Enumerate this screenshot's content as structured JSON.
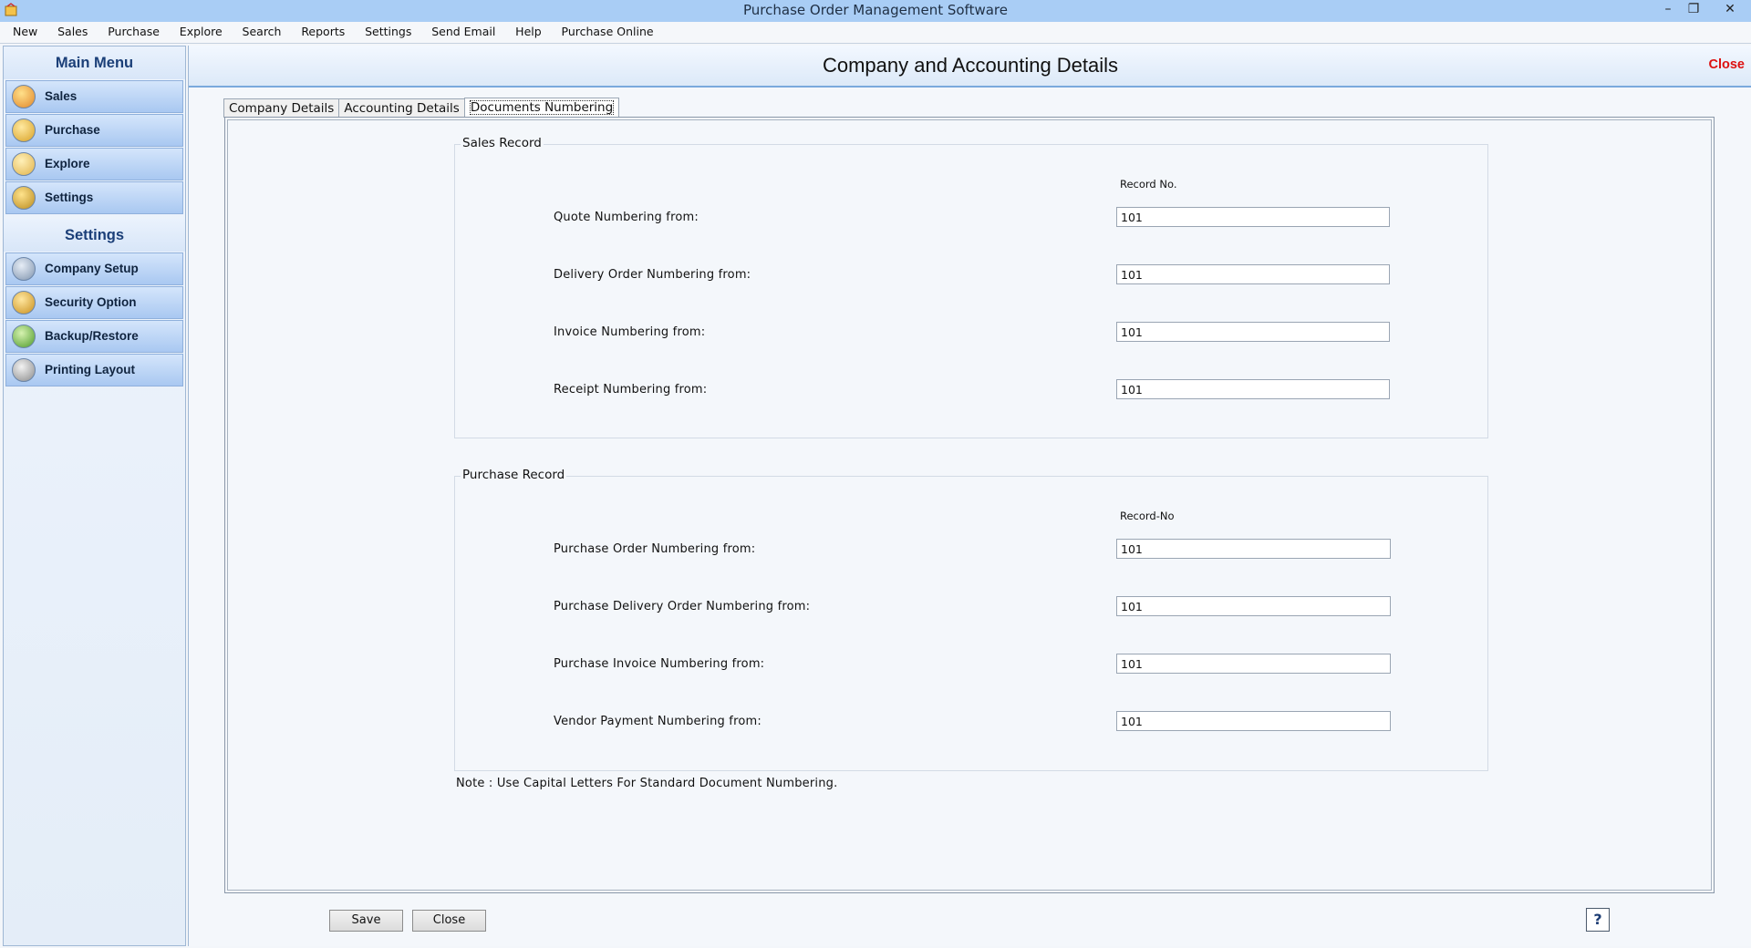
{
  "window": {
    "title": "Purchase Order Management Software",
    "minimize": "–",
    "restore": "❐",
    "close": "✕"
  },
  "menubar": [
    "New",
    "Sales",
    "Purchase",
    "Explore",
    "Search",
    "Reports",
    "Settings",
    "Send Email",
    "Help",
    "Purchase Online"
  ],
  "sidebar": {
    "main_header": "Main Menu",
    "main_items": [
      {
        "label": "Sales",
        "icon": "sales-chart-icon"
      },
      {
        "label": "Purchase",
        "icon": "purchase-box-icon"
      },
      {
        "label": "Explore",
        "icon": "explore-folder-icon"
      },
      {
        "label": "Settings",
        "icon": "settings-gear-icon"
      }
    ],
    "settings_header": "Settings",
    "settings_items": [
      {
        "label": "Company Setup",
        "icon": "company-setup-icon"
      },
      {
        "label": "Security Option",
        "icon": "security-lock-icon"
      },
      {
        "label": "Backup/Restore",
        "icon": "backup-restore-icon"
      },
      {
        "label": "Printing Layout",
        "icon": "printer-icon"
      }
    ]
  },
  "main": {
    "title": "Company and Accounting Details",
    "close_label": "Close",
    "tabs": [
      {
        "label": "Company Details",
        "active": false
      },
      {
        "label": "Accounting Details",
        "active": false
      },
      {
        "label": "Documents Numbering",
        "active": true
      }
    ]
  },
  "sales_record": {
    "legend": "Sales Record",
    "column_header": "Record No.",
    "fields": [
      {
        "label": "Quote Numbering from:",
        "value": "101"
      },
      {
        "label": "Delivery Order Numbering from:",
        "value": "101"
      },
      {
        "label": "Invoice Numbering from:",
        "value": "101"
      },
      {
        "label": "Receipt Numbering from:",
        "value": "101"
      }
    ]
  },
  "purchase_record": {
    "legend": "Purchase Record",
    "column_header": "Record-No",
    "fields": [
      {
        "label": "Purchase Order Numbering from:",
        "value": "101"
      },
      {
        "label": "Purchase Delivery Order Numbering from:",
        "value": "101"
      },
      {
        "label": "Purchase Invoice Numbering from:",
        "value": "101"
      },
      {
        "label": "Vendor Payment Numbering from:",
        "value": "101"
      }
    ]
  },
  "note": "Note :  Use Capital Letters For Standard Document Numbering.",
  "buttons": {
    "save": "Save",
    "close": "Close",
    "help": "?"
  },
  "colors": {
    "titlebar": "#a9cdf5",
    "sidebar_item": "#a9c8f1",
    "header_close": "#dd1111",
    "heading_blue": "#1b3f78"
  }
}
